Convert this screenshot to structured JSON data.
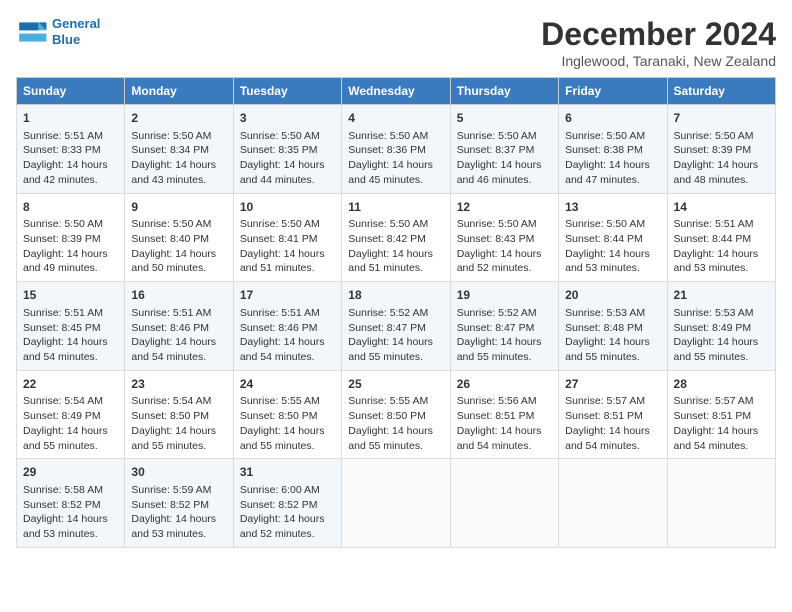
{
  "header": {
    "logo_line1": "General",
    "logo_line2": "Blue",
    "month": "December 2024",
    "location": "Inglewood, Taranaki, New Zealand"
  },
  "days_of_week": [
    "Sunday",
    "Monday",
    "Tuesday",
    "Wednesday",
    "Thursday",
    "Friday",
    "Saturday"
  ],
  "weeks": [
    [
      {
        "day": "1",
        "sunrise": "Sunrise: 5:51 AM",
        "sunset": "Sunset: 8:33 PM",
        "daylight": "Daylight: 14 hours and 42 minutes."
      },
      {
        "day": "2",
        "sunrise": "Sunrise: 5:50 AM",
        "sunset": "Sunset: 8:34 PM",
        "daylight": "Daylight: 14 hours and 43 minutes."
      },
      {
        "day": "3",
        "sunrise": "Sunrise: 5:50 AM",
        "sunset": "Sunset: 8:35 PM",
        "daylight": "Daylight: 14 hours and 44 minutes."
      },
      {
        "day": "4",
        "sunrise": "Sunrise: 5:50 AM",
        "sunset": "Sunset: 8:36 PM",
        "daylight": "Daylight: 14 hours and 45 minutes."
      },
      {
        "day": "5",
        "sunrise": "Sunrise: 5:50 AM",
        "sunset": "Sunset: 8:37 PM",
        "daylight": "Daylight: 14 hours and 46 minutes."
      },
      {
        "day": "6",
        "sunrise": "Sunrise: 5:50 AM",
        "sunset": "Sunset: 8:38 PM",
        "daylight": "Daylight: 14 hours and 47 minutes."
      },
      {
        "day": "7",
        "sunrise": "Sunrise: 5:50 AM",
        "sunset": "Sunset: 8:39 PM",
        "daylight": "Daylight: 14 hours and 48 minutes."
      }
    ],
    [
      {
        "day": "8",
        "sunrise": "Sunrise: 5:50 AM",
        "sunset": "Sunset: 8:39 PM",
        "daylight": "Daylight: 14 hours and 49 minutes."
      },
      {
        "day": "9",
        "sunrise": "Sunrise: 5:50 AM",
        "sunset": "Sunset: 8:40 PM",
        "daylight": "Daylight: 14 hours and 50 minutes."
      },
      {
        "day": "10",
        "sunrise": "Sunrise: 5:50 AM",
        "sunset": "Sunset: 8:41 PM",
        "daylight": "Daylight: 14 hours and 51 minutes."
      },
      {
        "day": "11",
        "sunrise": "Sunrise: 5:50 AM",
        "sunset": "Sunset: 8:42 PM",
        "daylight": "Daylight: 14 hours and 51 minutes."
      },
      {
        "day": "12",
        "sunrise": "Sunrise: 5:50 AM",
        "sunset": "Sunset: 8:43 PM",
        "daylight": "Daylight: 14 hours and 52 minutes."
      },
      {
        "day": "13",
        "sunrise": "Sunrise: 5:50 AM",
        "sunset": "Sunset: 8:44 PM",
        "daylight": "Daylight: 14 hours and 53 minutes."
      },
      {
        "day": "14",
        "sunrise": "Sunrise: 5:51 AM",
        "sunset": "Sunset: 8:44 PM",
        "daylight": "Daylight: 14 hours and 53 minutes."
      }
    ],
    [
      {
        "day": "15",
        "sunrise": "Sunrise: 5:51 AM",
        "sunset": "Sunset: 8:45 PM",
        "daylight": "Daylight: 14 hours and 54 minutes."
      },
      {
        "day": "16",
        "sunrise": "Sunrise: 5:51 AM",
        "sunset": "Sunset: 8:46 PM",
        "daylight": "Daylight: 14 hours and 54 minutes."
      },
      {
        "day": "17",
        "sunrise": "Sunrise: 5:51 AM",
        "sunset": "Sunset: 8:46 PM",
        "daylight": "Daylight: 14 hours and 54 minutes."
      },
      {
        "day": "18",
        "sunrise": "Sunrise: 5:52 AM",
        "sunset": "Sunset: 8:47 PM",
        "daylight": "Daylight: 14 hours and 55 minutes."
      },
      {
        "day": "19",
        "sunrise": "Sunrise: 5:52 AM",
        "sunset": "Sunset: 8:47 PM",
        "daylight": "Daylight: 14 hours and 55 minutes."
      },
      {
        "day": "20",
        "sunrise": "Sunrise: 5:53 AM",
        "sunset": "Sunset: 8:48 PM",
        "daylight": "Daylight: 14 hours and 55 minutes."
      },
      {
        "day": "21",
        "sunrise": "Sunrise: 5:53 AM",
        "sunset": "Sunset: 8:49 PM",
        "daylight": "Daylight: 14 hours and 55 minutes."
      }
    ],
    [
      {
        "day": "22",
        "sunrise": "Sunrise: 5:54 AM",
        "sunset": "Sunset: 8:49 PM",
        "daylight": "Daylight: 14 hours and 55 minutes."
      },
      {
        "day": "23",
        "sunrise": "Sunrise: 5:54 AM",
        "sunset": "Sunset: 8:50 PM",
        "daylight": "Daylight: 14 hours and 55 minutes."
      },
      {
        "day": "24",
        "sunrise": "Sunrise: 5:55 AM",
        "sunset": "Sunset: 8:50 PM",
        "daylight": "Daylight: 14 hours and 55 minutes."
      },
      {
        "day": "25",
        "sunrise": "Sunrise: 5:55 AM",
        "sunset": "Sunset: 8:50 PM",
        "daylight": "Daylight: 14 hours and 55 minutes."
      },
      {
        "day": "26",
        "sunrise": "Sunrise: 5:56 AM",
        "sunset": "Sunset: 8:51 PM",
        "daylight": "Daylight: 14 hours and 54 minutes."
      },
      {
        "day": "27",
        "sunrise": "Sunrise: 5:57 AM",
        "sunset": "Sunset: 8:51 PM",
        "daylight": "Daylight: 14 hours and 54 minutes."
      },
      {
        "day": "28",
        "sunrise": "Sunrise: 5:57 AM",
        "sunset": "Sunset: 8:51 PM",
        "daylight": "Daylight: 14 hours and 54 minutes."
      }
    ],
    [
      {
        "day": "29",
        "sunrise": "Sunrise: 5:58 AM",
        "sunset": "Sunset: 8:52 PM",
        "daylight": "Daylight: 14 hours and 53 minutes."
      },
      {
        "day": "30",
        "sunrise": "Sunrise: 5:59 AM",
        "sunset": "Sunset: 8:52 PM",
        "daylight": "Daylight: 14 hours and 53 minutes."
      },
      {
        "day": "31",
        "sunrise": "Sunrise: 6:00 AM",
        "sunset": "Sunset: 8:52 PM",
        "daylight": "Daylight: 14 hours and 52 minutes."
      },
      null,
      null,
      null,
      null
    ]
  ]
}
